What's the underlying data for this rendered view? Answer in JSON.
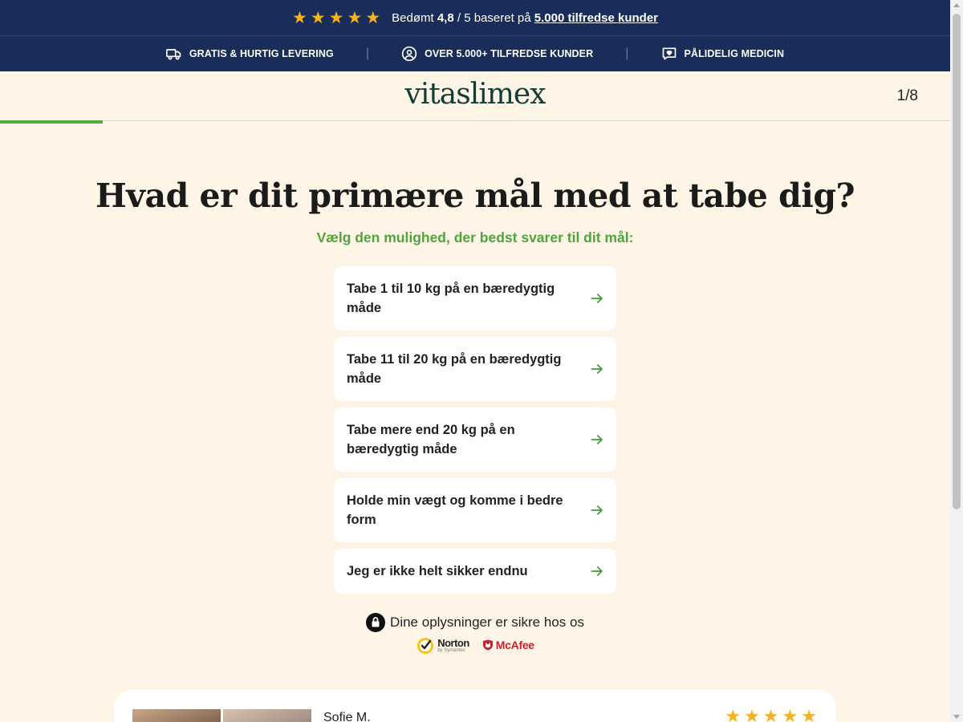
{
  "topbar": {
    "star_count": 5,
    "rating_prefix": "Bedømt",
    "rating_value": "4,8",
    "rating_middle": "/ 5 baseret på",
    "rating_link": "5.000 tilfredse kunder"
  },
  "trust": {
    "items": [
      {
        "label": "GRATIS & HURTIG LEVERING",
        "icon": "truck-icon"
      },
      {
        "label": "OVER 5.000+ TILFREDSE KUNDER",
        "icon": "user-circle-icon"
      },
      {
        "label": "PÅLIDELIG MEDICIN",
        "icon": "heart-message-icon"
      }
    ],
    "separator": "|"
  },
  "header": {
    "logo": "vitaslimex",
    "step": "1/8",
    "progress_fraction": 0.125
  },
  "quiz": {
    "title": "Hvad er dit primære mål med at tabe dig?",
    "subtitle": "Vælg den mulighed, der bedst svarer til dit mål:",
    "options": [
      "Tabe 1 til 10 kg på en bæredygtig måde",
      "Tabe 11 til 20 kg på en bæredygtig måde",
      "Tabe mere end 20 kg på en bæredygtig måde",
      "Holde min vægt og komme i bedre form",
      "Jeg er ikke helt sikker endnu"
    ]
  },
  "security": {
    "text": "Dine oplysninger er sikre hos os",
    "norton_name": "Norton",
    "norton_by": "by Symantec",
    "mcafee_name": "McAfee"
  },
  "review": {
    "name": "Sofie M.",
    "stars": 5
  },
  "colors": {
    "navy": "#1a2c59",
    "cream": "#fef5e7",
    "green": "#4caa3f",
    "star": "#f5b21b",
    "logo": "#133c37"
  }
}
